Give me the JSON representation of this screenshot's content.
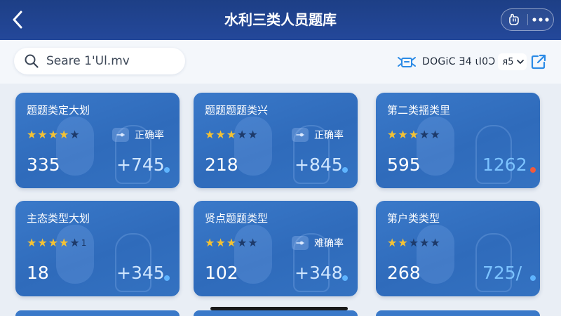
{
  "header": {
    "title": "水利三类人员题库",
    "icons": {
      "back": "chevron-left-icon",
      "capsule_left": "hand-icon",
      "capsule_right": "more-dots-icon"
    }
  },
  "toolbar": {
    "search_text": "Seare 1'Ul.mv",
    "filter_label": "DOGiC Ǝ4 ɩI0Ɔ",
    "filter_value": "ᴙ5",
    "icons": {
      "search": "search-icon",
      "filter": "box-arrows-icon",
      "dropdown": "chevron-down-icon",
      "export": "external-link-icon"
    }
  },
  "colors": {
    "header_bg": "#24489a",
    "card_bg": "#3472c1",
    "star_on": "#f4c234",
    "star_off": "#1d3a6a",
    "delta_blue": "#5fb4ff",
    "delta_light": "#bfe1ff",
    "dot_red": "#f05a3c"
  },
  "cards": [
    {
      "title": "题题类定大划",
      "rating": 4,
      "rating_extra": "",
      "badge": "正确率",
      "count": "335",
      "delta": "+745",
      "dot_color": "#5fb4ff",
      "delta_color": "#cfe6ff"
    },
    {
      "title": "题题题题类兴",
      "rating": 3,
      "rating_extra": "",
      "badge": "正确率",
      "count": "218",
      "delta": "+845",
      "dot_color": "#5fb4ff",
      "delta_color": "#cfe6ff"
    },
    {
      "title": "第二类揺类里",
      "rating": 3,
      "rating_extra": "",
      "badge": "",
      "count": "595",
      "delta": "1262",
      "dot_color": "#f05a3c",
      "delta_color": "#7cc3ff"
    },
    {
      "title": "主态类型大划",
      "rating": 4,
      "rating_extra": "1",
      "badge": "",
      "count": "18",
      "delta": "+345",
      "dot_color": "#5fb4ff",
      "delta_color": "#cfe6ff"
    },
    {
      "title": "贤点题题类型",
      "rating": 3,
      "rating_extra": "",
      "badge": "难确率",
      "count": "102",
      "delta": "+348",
      "dot_color": "#5fb4ff",
      "delta_color": "#cfe6ff"
    },
    {
      "title": "第户类类型",
      "rating": 2,
      "rating_extra": "",
      "badge": "",
      "count": "268",
      "delta": "725/",
      "dot_color": "#5fb4ff",
      "delta_color": "#7cc3ff"
    }
  ]
}
